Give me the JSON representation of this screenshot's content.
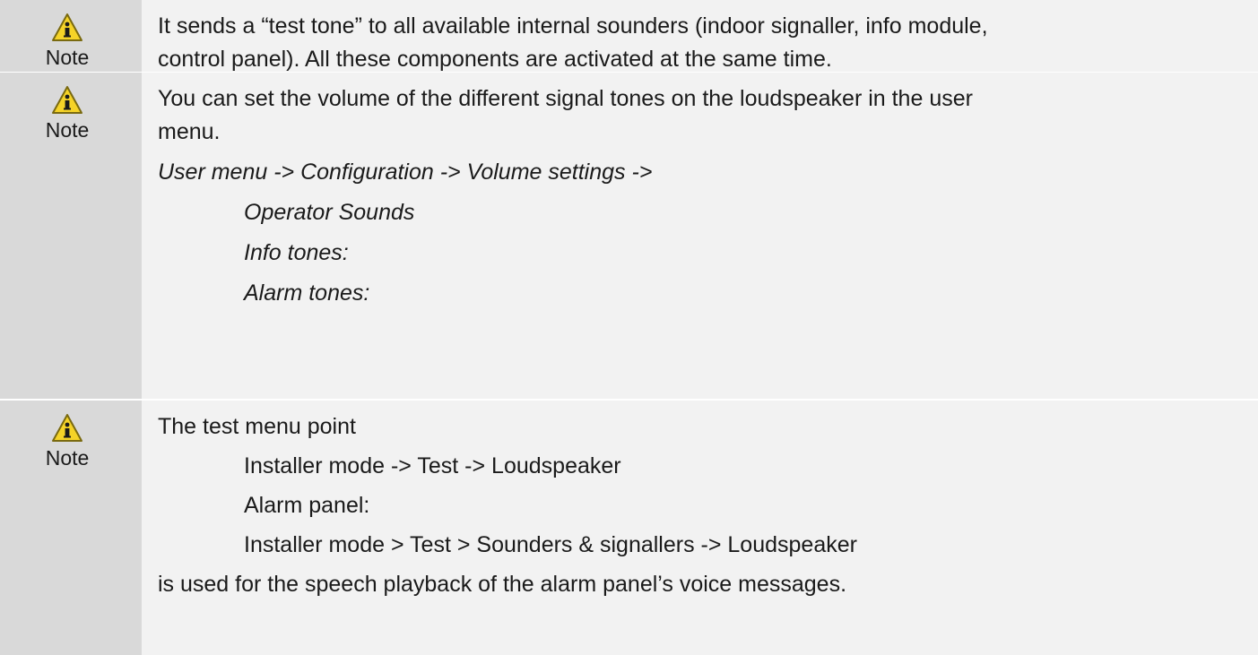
{
  "notes": [
    {
      "label": "Note",
      "icon": "warning-info-icon",
      "lines": [
        "It sends a “test tone” to all available internal sounders (indoor signaller, info module,",
        "control panel). All these components are activated at the same time."
      ]
    },
    {
      "label": "Note",
      "icon": "warning-info-icon",
      "lines": [
        "You can set the volume of the different signal tones on the loudspeaker in the user",
        "menu.",
        "User menu -> Configuration -> Volume settings ->",
        "Operator Sounds",
        "Info tones:",
        "Alarm tones:"
      ]
    },
    {
      "label": "Note",
      "icon": "warning-info-icon",
      "lines": [
        "The test menu point",
        "Installer mode -> Test -> Loudspeaker",
        "Alarm panel:",
        "Installer mode > Test > Sounders & signallers -> Loudspeaker",
        "is used for the speech playback of the alarm panel’s voice messages."
      ]
    }
  ],
  "colors": {
    "sidebar": "#d9d9d9",
    "content": "#f2f2f2",
    "icon_fill": "#f5d328",
    "icon_border": "#7a6a10"
  }
}
